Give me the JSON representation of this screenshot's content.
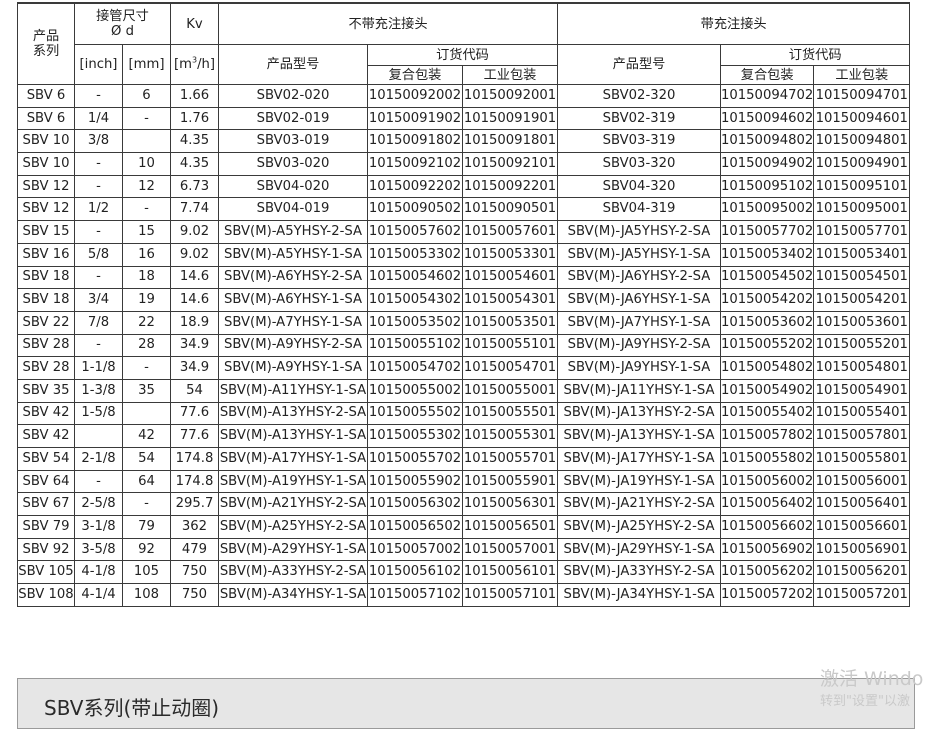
{
  "table": {
    "headers": {
      "series": "产品\n系列",
      "pipe_size": "接管尺寸\nØ d",
      "kv": "Kv",
      "inch": "[inch]",
      "mm": "[mm]",
      "unit_m3h_base": "[m",
      "unit_m3h_sup": "3",
      "unit_m3h_tail": "/h]",
      "without_connector": "不带充注接头",
      "with_connector": "带充注接头",
      "model": "产品型号",
      "order_code": "订货代码",
      "compound_pack": "复合包装",
      "industrial_pack": "工业包装"
    },
    "rows": [
      [
        "SBV 6",
        "-",
        "6",
        "1.66",
        "SBV02-020",
        "10150092002",
        "10150092001",
        "SBV02-320",
        "10150094702",
        "10150094701"
      ],
      [
        "SBV 6",
        "1/4",
        "-",
        "1.76",
        "SBV02-019",
        "10150091902",
        "10150091901",
        "SBV02-319",
        "10150094602",
        "10150094601"
      ],
      [
        "SBV 10",
        "3/8",
        "",
        "4.35",
        "SBV03-019",
        "10150091802",
        "10150091801",
        "SBV03-319",
        "10150094802",
        "10150094801"
      ],
      [
        "SBV 10",
        "-",
        "10",
        "4.35",
        "SBV03-020",
        "10150092102",
        "10150092101",
        "SBV03-320",
        "10150094902",
        "10150094901"
      ],
      [
        "SBV 12",
        "-",
        "12",
        "6.73",
        "SBV04-020",
        "10150092202",
        "10150092201",
        "SBV04-320",
        "10150095102",
        "10150095101"
      ],
      [
        "SBV 12",
        "1/2",
        "-",
        "7.74",
        "SBV04-019",
        "10150090502",
        "10150090501",
        "SBV04-319",
        "10150095002",
        "10150095001"
      ],
      [
        "SBV 15",
        "-",
        "15",
        "9.02",
        "SBV(M)-A5YHSY-2-SA",
        "10150057602",
        "10150057601",
        "SBV(M)-JA5YHSY-2-SA",
        "10150057702",
        "10150057701"
      ],
      [
        "SBV 16",
        "5/8",
        "16",
        "9.02",
        "SBV(M)-A5YHSY-1-SA",
        "10150053302",
        "10150053301",
        "SBV(M)-JA5YHSY-1-SA",
        "10150053402",
        "10150053401"
      ],
      [
        "SBV 18",
        "-",
        "18",
        "14.6",
        "SBV(M)-A6YHSY-2-SA",
        "10150054602",
        "10150054601",
        "SBV(M)-JA6YHSY-2-SA",
        "10150054502",
        "10150054501"
      ],
      [
        "SBV 18",
        "3/4",
        "19",
        "14.6",
        "SBV(M)-A6YHSY-1-SA",
        "10150054302",
        "10150054301",
        "SBV(M)-JA6YHSY-1-SA",
        "10150054202",
        "10150054201"
      ],
      [
        "SBV 22",
        "7/8",
        "22",
        "18.9",
        "SBV(M)-A7YHSY-1-SA",
        "10150053502",
        "10150053501",
        "SBV(M)-JA7YHSY-1-SA",
        "10150053602",
        "10150053601"
      ],
      [
        "SBV 28",
        "-",
        "28",
        "34.9",
        "SBV(M)-A9YHSY-2-SA",
        "10150055102",
        "10150055101",
        "SBV(M)-JA9YHSY-2-SA",
        "10150055202",
        "10150055201"
      ],
      [
        "SBV 28",
        "1-1/8",
        "-",
        "34.9",
        "SBV(M)-A9YHSY-1-SA",
        "10150054702",
        "10150054701",
        "SBV(M)-JA9YHSY-1-SA",
        "10150054802",
        "10150054801"
      ],
      [
        "SBV 35",
        "1-3/8",
        "35",
        "54",
        "SBV(M)-A11YHSY-1-SA",
        "10150055002",
        "10150055001",
        "SBV(M)-JA11YHSY-1-SA",
        "10150054902",
        "10150054901"
      ],
      [
        "SBV 42",
        "1-5/8",
        "",
        "77.6",
        "SBV(M)-A13YHSY-2-SA",
        "10150055502",
        "10150055501",
        "SBV(M)-JA13YHSY-2-SA",
        "10150055402",
        "10150055401"
      ],
      [
        "SBV 42",
        "",
        "42",
        "77.6",
        "SBV(M)-A13YHSY-1-SA",
        "10150055302",
        "10150055301",
        "SBV(M)-JA13YHSY-1-SA",
        "10150057802",
        "10150057801"
      ],
      [
        "SBV 54",
        "2-1/8",
        "54",
        "174.8",
        "SBV(M)-A17YHSY-1-SA",
        "10150055702",
        "10150055701",
        "SBV(M)-JA17YHSY-1-SA",
        "10150055802",
        "10150055801"
      ],
      [
        "SBV 64",
        "-",
        "64",
        "174.8",
        "SBV(M)-A19YHSY-1-SA",
        "10150055902",
        "10150055901",
        "SBV(M)-JA19YHSY-1-SA",
        "10150056002",
        "10150056001"
      ],
      [
        "SBV 67",
        "2-5/8",
        "-",
        "295.7",
        "SBV(M)-A21YHSY-2-SA",
        "10150056302",
        "10150056301",
        "SBV(M)-JA21YHSY-2-SA",
        "10150056402",
        "10150056401"
      ],
      [
        "SBV 79",
        "3-1/8",
        "79",
        "362",
        "SBV(M)-A25YHSY-2-SA",
        "10150056502",
        "10150056501",
        "SBV(M)-JA25YHSY-2-SA",
        "10150056602",
        "10150056601"
      ],
      [
        "SBV 92",
        "3-5/8",
        "92",
        "479",
        "SBV(M)-A29YHSY-1-SA",
        "10150057002",
        "10150057001",
        "SBV(M)-JA29YHSY-1-SA",
        "10150056902",
        "10150056901"
      ],
      [
        "SBV 105",
        "4-1/8",
        "105",
        "750",
        "SBV(M)-A33YHSY-2-SA",
        "10150056102",
        "10150056101",
        "SBV(M)-JA33YHSY-2-SA",
        "10150056202",
        "10150056201"
      ],
      [
        "SBV 108",
        "4-1/4",
        "108",
        "750",
        "SBV(M)-A34YHSY-1-SA",
        "10150057102",
        "10150057101",
        "SBV(M)-JA34YHSY-1-SA",
        "10150057202",
        "10150057201"
      ]
    ]
  },
  "section": {
    "title": "SBV系列(带止动圈)"
  },
  "watermark": {
    "line1": "激活 Windo",
    "line2": "转到\"设置\"以激"
  }
}
